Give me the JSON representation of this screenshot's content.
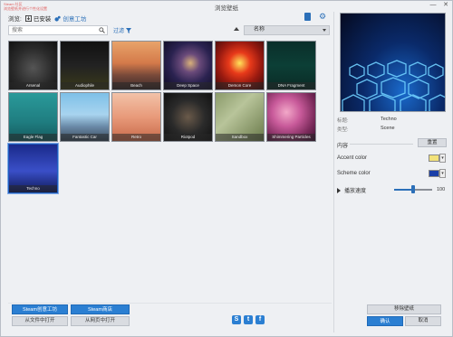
{
  "window": {
    "title": "浏览壁纸",
    "watermark_line1": "Steam 社区",
    "watermark_line2": "浏览壁纸并进行个性化设置"
  },
  "toolbar": {
    "browse_label": "浏览:",
    "installed": "已安装",
    "workshop": "创意工坊"
  },
  "search": {
    "placeholder": "搜索"
  },
  "filter": {
    "label": "过滤"
  },
  "sort": {
    "selected": "名称"
  },
  "wallpapers": [
    {
      "name": "Arsenal"
    },
    {
      "name": "Audiophile"
    },
    {
      "name": "Beach"
    },
    {
      "name": "Deep Space"
    },
    {
      "name": "Demon Core"
    },
    {
      "name": "DNA Fragment"
    },
    {
      "name": "Eagle Flag"
    },
    {
      "name": "Fantastic Car"
    },
    {
      "name": "Retro"
    },
    {
      "name": "Riotpod"
    },
    {
      "name": "Sandbox"
    },
    {
      "name": "Shimmering Particles"
    },
    {
      "name": "Techno"
    }
  ],
  "details": {
    "title_label": "标题:",
    "title_value": "Techno",
    "type_label": "类型:",
    "type_value": "Scene"
  },
  "content": {
    "section_label": "内容",
    "reset_button": "重置",
    "accent_label": "Accent color",
    "accent_color": "#f2e27a",
    "scheme_label": "Scheme color",
    "scheme_color": "#1a3fa8",
    "speed_label": "播放速度",
    "speed_value": "100",
    "speed_fraction": 0.5
  },
  "buttons": {
    "steam_workshop": "Steam创意工坊",
    "steam_store": "Steam商店",
    "open_file": "从文件中打开",
    "open_web": "从网页中打开",
    "remove_wallpaper": "移除壁纸",
    "ok": "确认",
    "cancel": "取消"
  },
  "social": {
    "steam": "S",
    "twitter": "t",
    "facebook": "f"
  }
}
